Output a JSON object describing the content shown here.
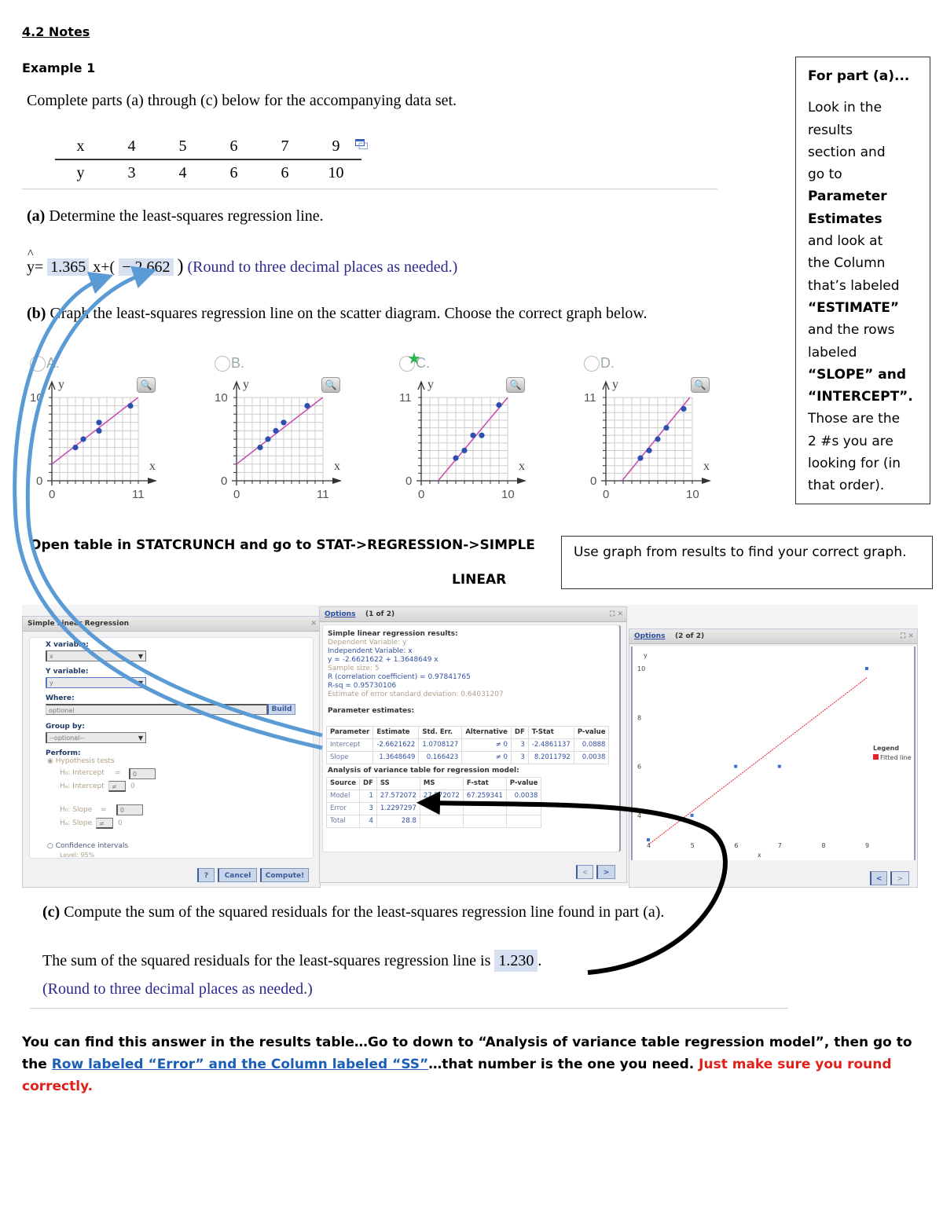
{
  "header": {
    "title": "4.2 Notes",
    "example": "Example 1"
  },
  "problem": {
    "prompt": "Complete parts (a) through (c) below for the accompanying data set.",
    "table": {
      "x_label": "x",
      "y_label": "y",
      "x": [
        "4",
        "5",
        "6",
        "7",
        "9"
      ],
      "y": [
        "3",
        "4",
        "6",
        "6",
        "10"
      ]
    },
    "popout_icon": "popout-window-icon"
  },
  "part_a": {
    "question_label": "(a)",
    "question": " Determine the least-squares regression line.",
    "yhat": "y",
    "hat": "^",
    "eq": "=",
    "slope": "1.365",
    "x_plus": "x+(",
    "intercept": "− 2.662",
    "close": ")",
    "hint": "(Round to three decimal places as needed.)"
  },
  "part_b": {
    "question_label": "(b)",
    "question": " Graph the least-squares regression line on the scatter diagram. Choose the correct graph below.",
    "choices": [
      {
        "label": "A.",
        "y_max": "10",
        "x_max": "11",
        "selected": false
      },
      {
        "label": "B.",
        "y_max": "10",
        "x_max": "11",
        "selected": false
      },
      {
        "label": "C.",
        "y_max": "11",
        "x_max": "10",
        "selected": true
      },
      {
        "label": "D.",
        "y_max": "11",
        "x_max": "10",
        "selected": false
      }
    ],
    "axis_zero": "0",
    "axis_x": "x",
    "axis_y": "y",
    "zoom_icon": "magnifier-plus-icon",
    "correct_icon": "star-icon"
  },
  "sidebar_note": {
    "heading": "For part (a)...",
    "lines": [
      {
        "text": "Look in the",
        "bold": false
      },
      {
        "text": "results",
        "bold": false
      },
      {
        "text": "section and",
        "bold": false
      },
      {
        "text": "go to",
        "bold": false
      },
      {
        "text": "Parameter",
        "bold": true
      },
      {
        "text": "Estimates",
        "bold": true
      },
      {
        "text": "and look at",
        "bold": false
      },
      {
        "text": "the Column",
        "bold": false
      },
      {
        "text": "that’s labeled",
        "bold": false
      },
      {
        "text": "“ESTIMATE”",
        "bold": true
      },
      {
        "text": "and the rows",
        "bold": false
      },
      {
        "text": "labeled",
        "bold": false
      },
      {
        "text": "“SLOPE” and",
        "bold": true
      },
      {
        "text": "“INTERCEPT”.",
        "bold": true
      },
      {
        "text": "Those are the",
        "bold": false
      },
      {
        "text": "2 #s you are",
        "bold": false
      },
      {
        "text": "looking for (in",
        "bold": false
      },
      {
        "text": "that order).",
        "bold": false
      }
    ]
  },
  "statcrunch_instructions": {
    "line1": "Open table in STATCRUNCH and go to STAT->REGRESSION->SIMPLE",
    "line2": "LINEAR",
    "graph_note": "Use graph from results to find your correct graph."
  },
  "dialog": {
    "title": "Simple Linear Regression",
    "x_label": "X variable:",
    "x_value": "x",
    "y_label": "Y variable:",
    "y_value": "y",
    "where_label": "Where:",
    "where_placeholder": "optional",
    "build": "Build",
    "group_label": "Group by:",
    "group_value": "--optional--",
    "perform_label": "Perform:",
    "hyp_tests": "Hypothesis tests",
    "h0_intercept": "H₀: Intercept",
    "h0_int_op": "=",
    "h0_int_val": "0",
    "ha_intercept": "Hₐ: Intercept",
    "ha_int_op": "≠",
    "ha_int_val": "0",
    "h0_slope": "H₀: Slope",
    "h0_slope_op": "=",
    "h0_slope_val": "0",
    "ha_slope": "Hₐ: Slope",
    "ha_slope_op": "≠",
    "ha_slope_val": "0",
    "conf_int": "Confidence intervals",
    "level": "Level: 95%",
    "help": "?",
    "cancel": "Cancel",
    "compute": "Compute!"
  },
  "results": {
    "options": "Options",
    "page": "(1 of 2)",
    "heading": "Simple linear regression results:",
    "dep": "Dependent Variable: y",
    "indep": "Independent Variable: x",
    "equation": "y = -2.6621622 + 1.3648649 x",
    "sample_size": "Sample size: 5",
    "r": "R (correlation coefficient) = 0.97841765",
    "rsq": "R-sq = 0.95730106",
    "est_err": "Estimate of error standard deviation: 0.64031207",
    "param_heading": "Parameter estimates:",
    "param_cols": [
      "Parameter",
      "Estimate",
      "Std. Err.",
      "Alternative",
      "DF",
      "T-Stat",
      "P-value"
    ],
    "param_rows": [
      [
        "Intercept",
        "-2.6621622",
        "1.0708127",
        "≠ 0",
        "3",
        "-2.4861137",
        "0.0888"
      ],
      [
        "Slope",
        "1.3648649",
        "0.166423",
        "≠ 0",
        "3",
        "8.2011792",
        "0.0038"
      ]
    ],
    "anova_heading": "Analysis of variance table for regression model:",
    "anova_cols": [
      "Source",
      "DF",
      "SS",
      "MS",
      "F-stat",
      "P-value"
    ],
    "anova_rows": [
      [
        "Model",
        "1",
        "27.572072",
        "27.572072",
        "67.259341",
        "0.0038"
      ],
      [
        "Error",
        "3",
        "1.2297297",
        "",
        "",
        ""
      ],
      [
        "Total",
        "4",
        "28.8",
        "",
        "",
        ""
      ]
    ],
    "prev": "<",
    "next": ">"
  },
  "graph_window": {
    "options": "Options",
    "page": "(2 of 2)",
    "y_axis": "y",
    "x_axis": "x",
    "legend_title": "Legend",
    "legend_item": "Fitted line",
    "legend_color": "#e8202a",
    "prev": "<",
    "next": ">"
  },
  "part_c": {
    "question_label": "(c)",
    "question": " Compute the sum of the squared residuals for the least-squares regression line found in part (a).",
    "answer_prefix": "The sum of the squared residuals for the least-squares regression line is",
    "answer": "1.230",
    "answer_suffix": ".",
    "hint": "(Round to three decimal places as needed.)"
  },
  "bottom_note": {
    "text1": "You can find this answer in the results table…Go to down to “Analysis of variance table regression model”, then go to the ",
    "link": "Row labeled “Error” and the Column labeled “SS”",
    "text2": "…that number is the one you need. ",
    "red": "Just make sure you round correctly."
  },
  "colors": {
    "answer_bg": "#d7e0f0",
    "hint": "#2a2a8a",
    "arrow_blue": "#5b9bd5",
    "arrow_black": "#000000",
    "regression_line": "#c94fb0",
    "point": "#2f4fb0",
    "link": "#1a5fb4",
    "warning": "#e0201a"
  },
  "chart_data": [
    {
      "type": "scatter",
      "title": "A",
      "x": [
        3,
        4,
        6,
        6,
        10
      ],
      "y": [
        4,
        5,
        6,
        7,
        9
      ],
      "line": {
        "slope": 0.73,
        "intercept": 2
      },
      "xlim": [
        0,
        11
      ],
      "ylim": [
        0,
        10
      ]
    },
    {
      "type": "scatter",
      "title": "B",
      "x": [
        3,
        4,
        5,
        6,
        9
      ],
      "y": [
        4,
        5,
        6,
        7,
        9
      ],
      "line": {
        "slope": 0.73,
        "intercept": 2
      },
      "xlim": [
        0,
        11
      ],
      "ylim": [
        0,
        10
      ]
    },
    {
      "type": "scatter",
      "title": "C",
      "x": [
        4,
        5,
        6,
        7,
        9
      ],
      "y": [
        3,
        4,
        6,
        6,
        10
      ],
      "line": {
        "slope": 1.365,
        "intercept": -2.662
      },
      "xlim": [
        0,
        10
      ],
      "ylim": [
        0,
        11
      ]
    },
    {
      "type": "scatter",
      "title": "D",
      "x": [
        4,
        5,
        6,
        7,
        9
      ],
      "y": [
        3,
        4,
        5.5,
        7,
        9.5
      ],
      "line": {
        "slope": 1.4,
        "intercept": -2.6
      },
      "xlim": [
        0,
        10
      ],
      "ylim": [
        0,
        11
      ]
    },
    {
      "type": "scatter",
      "title": "StatCrunch fitted line",
      "x": [
        4,
        5,
        6,
        7,
        9
      ],
      "y": [
        3,
        4,
        6,
        6,
        10
      ],
      "line": {
        "slope": 1.3648649,
        "intercept": -2.6621622
      },
      "xlim": [
        4,
        9
      ],
      "ylim": [
        3,
        10
      ]
    }
  ]
}
